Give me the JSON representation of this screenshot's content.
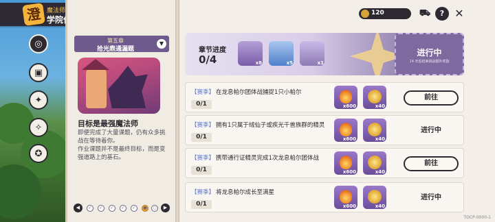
{
  "header": {
    "book_subtitle": "魔法师手册",
    "book_title": "学院作业",
    "logo_glyph": "澄"
  },
  "topbar": {
    "coins": "120",
    "icons": [
      "shop-cart-icon",
      "help-icon",
      "close-icon"
    ]
  },
  "sidebar": {
    "items": [
      {
        "name": "target",
        "glyph": "◎",
        "active": true
      },
      {
        "name": "bag",
        "glyph": "▣",
        "active": false
      },
      {
        "name": "star",
        "glyph": "✦",
        "active": false
      },
      {
        "name": "compass",
        "glyph": "✧",
        "active": false
      },
      {
        "name": "badge",
        "glyph": "✪",
        "active": false
      }
    ]
  },
  "chapter": {
    "number": "第五章",
    "name": "拾光鼎通漏题",
    "goal_title": "目标是最强魔法师",
    "goal_desc": "即便完成了大量课题，仍有众多挑战在等待着你。\n作业课题并不是最终目标，而是变强道路上的基石。",
    "pager": [
      "◀",
      "✓",
      "✓",
      "✓",
      "✓",
      "✓",
      "●",
      "○",
      "▶"
    ]
  },
  "progress": {
    "label": "章节进度",
    "value": "0/4",
    "rewards": [
      {
        "icon": "crystal-icon",
        "count": "x8",
        "color": "#7a5ca8"
      },
      {
        "icon": "orb-icon",
        "count": "x5",
        "color": "#4e7fc9"
      },
      {
        "icon": "flower-icon",
        "count": "x1",
        "color": "#8e7ab5"
      }
    ],
    "status": "进行中",
    "status_sub": "14 天后结束挑战额外奖励"
  },
  "tasks": [
    {
      "tag": "【赛季】",
      "text": "在龙息帕尔团体战捕捉1只小帕尔",
      "progress": "0/1",
      "reward1": "x600",
      "reward2": "x40",
      "action": "前往",
      "is_button": true
    },
    {
      "tag": "【赛季】",
      "text": "拥有1只属于绒仙子或疾光千兽族群的精灵",
      "progress": "0/1",
      "reward1": "x600",
      "reward2": "x40",
      "action": "进行中",
      "is_button": false
    },
    {
      "tag": "【赛季】",
      "text": "携带通行证精灵完成1次龙息帕尔团体战",
      "progress": "0/1",
      "reward1": "x600",
      "reward2": "x40",
      "action": "前往",
      "is_button": true
    },
    {
      "tag": "【赛季】",
      "text": "将龙息帕尔成长至满星",
      "progress": "0/1",
      "reward1": "x600",
      "reward2": "x40",
      "action": "进行中",
      "is_button": false
    }
  ],
  "version": "TOCP-0000-1"
}
